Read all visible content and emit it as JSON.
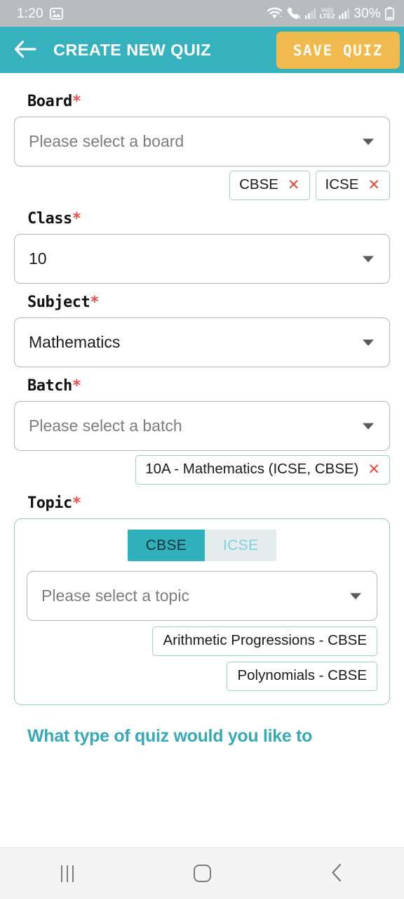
{
  "status_bar": {
    "time": "1:20",
    "left_icon": "gallery-image-icon",
    "wifi_icon": "wifi-icon",
    "call_icon": "call-forward-icon",
    "signal1_icon": "signal-bars-icon",
    "network_label": "VoLTE2",
    "network_top": "Vo)))",
    "network_bottom": "LTE2",
    "signal2_icon": "signal-bars-icon",
    "battery_percent": "30%",
    "battery_icon": "battery-low-icon"
  },
  "header": {
    "back_icon": "back-arrow-icon",
    "title": "CREATE NEW QUIZ",
    "save_label": "SAVE QUIZ",
    "bg_color": "#35b2be",
    "save_bg_color": "#efb94e"
  },
  "form": {
    "required_marker": "*",
    "caret_icon": "chevron-down-icon",
    "remove_icon": "close-x-icon",
    "fields": [
      {
        "name": "board",
        "label": "Board",
        "required": true,
        "select_value": "Please select a board",
        "is_placeholder": true,
        "chips": [
          {
            "label": "CBSE",
            "removable": true
          },
          {
            "label": "ICSE",
            "removable": true
          }
        ]
      },
      {
        "name": "class",
        "label": "Class",
        "required": true,
        "select_value": "10",
        "is_placeholder": false,
        "chips": []
      },
      {
        "name": "subject",
        "label": "Subject",
        "required": true,
        "select_value": "Mathematics",
        "is_placeholder": false,
        "chips": []
      },
      {
        "name": "batch",
        "label": "Batch",
        "required": true,
        "select_value": "Please select a batch",
        "is_placeholder": true,
        "chips": [
          {
            "label": "10A - Mathematics (ICSE, CBSE)",
            "removable": true
          }
        ]
      }
    ],
    "topic": {
      "label": "Topic",
      "required": true,
      "tabs": [
        {
          "label": "CBSE",
          "active": true
        },
        {
          "label": "ICSE",
          "active": false
        }
      ],
      "select_value": "Please select a topic",
      "is_placeholder": true,
      "chips": [
        {
          "label": "Arithmetic Progressions - CBSE",
          "removable": false
        },
        {
          "label": "Polynomials - CBSE",
          "removable": false
        }
      ]
    },
    "quiz_type_prompt": "What type of quiz would you like to",
    "accent_color": "#36aab6"
  },
  "nav_bar": {
    "recents_icon": "recents-icon",
    "home_icon": "home-icon",
    "back_icon": "back-chevron-icon"
  }
}
